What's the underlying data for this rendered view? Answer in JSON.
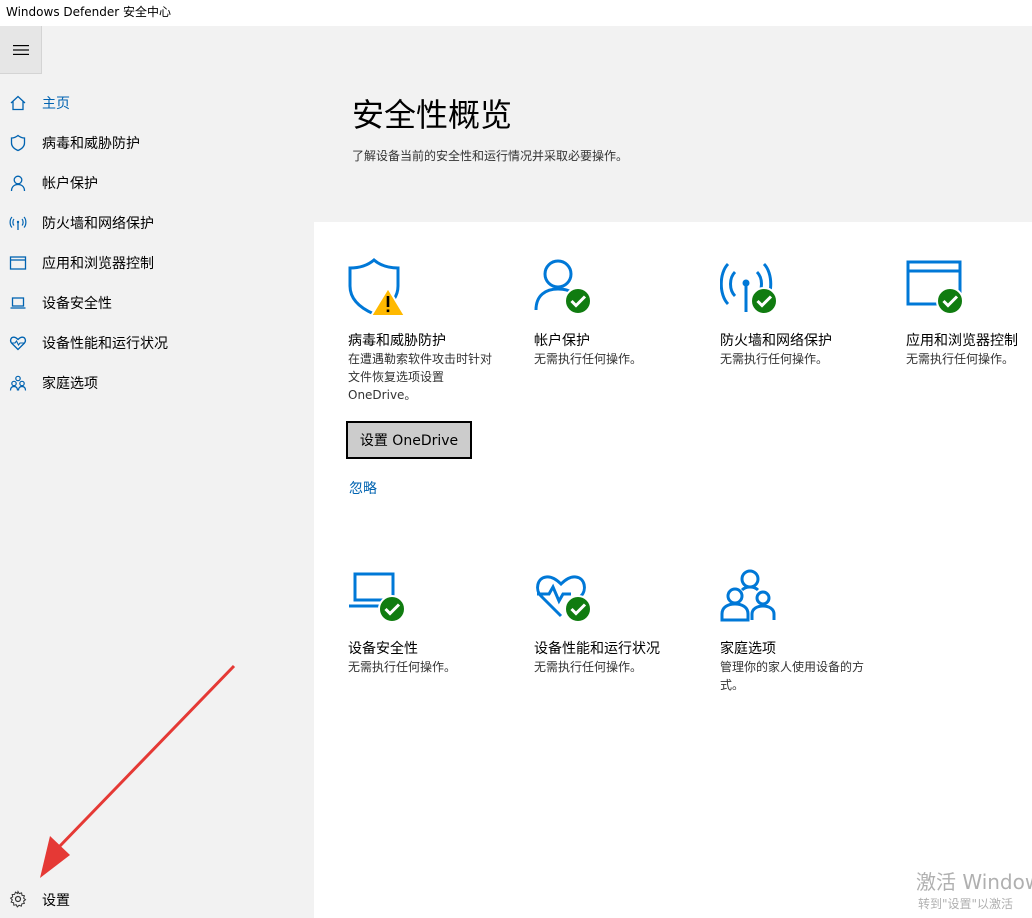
{
  "window": {
    "title": "Windows Defender 安全中心"
  },
  "sidebar": {
    "items": [
      {
        "label": "主页",
        "icon": "home-icon"
      },
      {
        "label": "病毒和威胁防护",
        "icon": "shield-icon"
      },
      {
        "label": "帐户保护",
        "icon": "person-icon"
      },
      {
        "label": "防火墙和网络保护",
        "icon": "wireless-icon"
      },
      {
        "label": "应用和浏览器控制",
        "icon": "browser-window-icon"
      },
      {
        "label": "设备安全性",
        "icon": "laptop-icon"
      },
      {
        "label": "设备性能和运行状况",
        "icon": "heart-icon"
      },
      {
        "label": "家庭选项",
        "icon": "family-icon"
      }
    ],
    "settings_label": "设置"
  },
  "header": {
    "title": "安全性概览",
    "subtitle": "了解设备当前的安全性和运行情况并采取必要操作。"
  },
  "tiles": [
    {
      "title": "病毒和威胁防护",
      "desc_lines": [
        "在遭遇勒索软件攻击时针对",
        "文件恢复选项设置",
        "OneDrive。"
      ],
      "status": "warning"
    },
    {
      "title": "帐户保护",
      "desc_lines": [
        "无需执行任何操作。"
      ],
      "status": "ok"
    },
    {
      "title": "防火墙和网络保护",
      "desc_lines": [
        "无需执行任何操作。"
      ],
      "status": "ok"
    },
    {
      "title": "应用和浏览器控制",
      "desc_lines": [
        "无需执行任何操作。"
      ],
      "status": "ok"
    },
    {
      "title": "设备安全性",
      "desc_lines": [
        "无需执行任何操作。"
      ],
      "status": "ok"
    },
    {
      "title": "设备性能和运行状况",
      "desc_lines": [
        "无需执行任何操作。"
      ],
      "status": "ok"
    },
    {
      "title": "家庭选项",
      "desc_lines": [
        "管理你的家人使用设备的方",
        "式。"
      ],
      "status": "none"
    }
  ],
  "actions": {
    "onedrive_button": "设置 OneDrive",
    "ignore_link": "忽略"
  },
  "watermark": {
    "line1": "激活 Windows",
    "line2": "转到\"设置\"以激活"
  },
  "colors": {
    "accent": "#0063b1",
    "icon_blue": "#0078d7",
    "ok_green": "#107c10",
    "warning_yellow": "#ffb900"
  }
}
